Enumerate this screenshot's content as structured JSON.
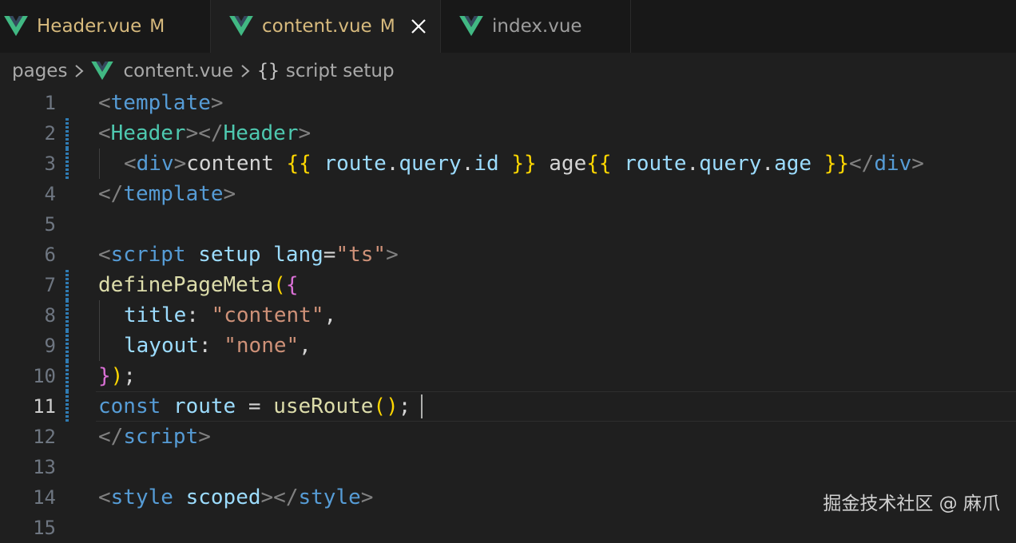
{
  "tabs": [
    {
      "label": "Header.vue",
      "modified": "M"
    },
    {
      "label": "content.vue",
      "modified": "M",
      "close": "×"
    },
    {
      "label": "index.vue"
    }
  ],
  "breadcrumb": {
    "folder": "pages",
    "file": "content.vue",
    "symbol_icon": "{}",
    "symbol": "script setup"
  },
  "editor": {
    "line_numbers": [
      "1",
      "2",
      "3",
      "4",
      "5",
      "6",
      "7",
      "8",
      "9",
      "10",
      "11",
      "12",
      "13",
      "14",
      "15"
    ],
    "current_line": "11",
    "tokens": {
      "l1": [
        "<",
        "template",
        ">"
      ],
      "l2": [
        "<",
        "Header",
        "></",
        "Header",
        ">"
      ],
      "l3": [
        "<",
        "div",
        ">",
        "content ",
        "{{",
        " route",
        ".",
        "query",
        ".",
        "id",
        " ",
        "}}",
        " age",
        "{{",
        " route",
        ".",
        "query",
        ".",
        "age",
        " ",
        "}}",
        "</",
        "div",
        ">"
      ],
      "l4": [
        "</",
        "template",
        ">"
      ],
      "l6": [
        "<",
        "script",
        " ",
        "setup",
        " ",
        "lang",
        "=",
        "\"ts\"",
        ">"
      ],
      "l7": [
        "definePageMeta",
        "(",
        "{"
      ],
      "l8": [
        "title",
        ": ",
        "\"content\"",
        ","
      ],
      "l9": [
        "layout",
        ": ",
        "\"none\"",
        ","
      ],
      "l10": [
        "}",
        ")",
        ";"
      ],
      "l11": [
        "const",
        " ",
        "route",
        " = ",
        "useRoute",
        "()",
        ";"
      ],
      "l12": [
        "</",
        "script",
        ">"
      ],
      "l14": [
        "<",
        "style",
        " ",
        "scoped",
        "></",
        "style",
        ">"
      ]
    }
  },
  "watermark": "掘金技术社区 @ 麻爪",
  "colors": {
    "background": "#1f1f1f",
    "tabbar": "#181818",
    "vue_green": "#41b883",
    "modified": "#d7ba7d",
    "tag": "#569cd6",
    "component": "#4ec9b0",
    "string": "#ce9178",
    "attribute": "#9cdcfe",
    "function": "#dcdcaa",
    "bracket_gold": "#ffd700",
    "bracket_pink": "#da70d6",
    "gutter_modified": "#2f7bb3"
  }
}
